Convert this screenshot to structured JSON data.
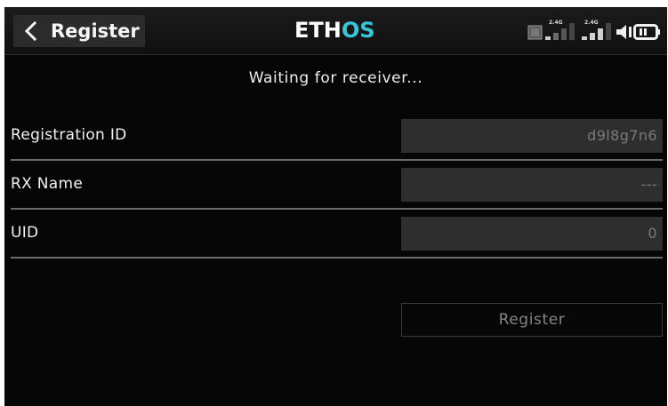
{
  "header": {
    "back_icon": "chevron-left-icon",
    "title": "Register",
    "logo": {
      "prefix": "ETH",
      "accent": "OS",
      "accent_color": "#36c6da"
    },
    "status_icons": {
      "rf_band_1": "2.4G",
      "rf_band_2": "2.4G",
      "signal_1_level": 0.25,
      "signal_2_level": 0.75,
      "speaker_icon": "speaker-icon",
      "battery_icon": "battery-icon"
    }
  },
  "main": {
    "status_message": "Waiting for receiver...",
    "rows": [
      {
        "label": "Registration ID",
        "value": "d9l8g7n6"
      },
      {
        "label": "RX Name",
        "value": "---"
      },
      {
        "label": "UID",
        "value": "0"
      }
    ],
    "register_button_label": "Register"
  },
  "colors": {
    "background": "#060606",
    "field_background": "#2e2e2e",
    "field_text": "#7a7a7a",
    "divider": "#6a6a6a",
    "accent": "#36c6da"
  }
}
